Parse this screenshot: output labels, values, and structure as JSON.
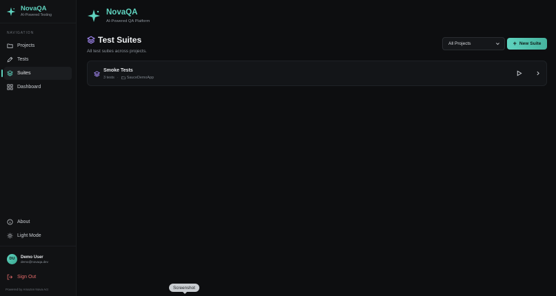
{
  "brand": {
    "name": "NovaQA",
    "tagline": "AI-Powered Testing"
  },
  "sidebar": {
    "heading": "NAVIGATION",
    "items": [
      {
        "label": "Projects",
        "icon": "folder-icon"
      },
      {
        "label": "Tests",
        "icon": "pencil-icon"
      },
      {
        "label": "Suites",
        "icon": "layers-icon",
        "active": true
      },
      {
        "label": "Dashboard",
        "icon": "grid-icon"
      }
    ],
    "about_label": "About",
    "light_mode_label": "Light Mode",
    "user": {
      "initials": "DU",
      "name": "Demo User",
      "email": "demo@novaqa.dev"
    },
    "sign_out_label": "Sign Out",
    "powered_by": "Powered by Amazon Nova Act"
  },
  "header": {
    "brand_name": "NovaQA",
    "brand_sub": "AI-Powered QA Platform"
  },
  "page": {
    "title": "Test Suites",
    "subtitle": "All test suites across projects.",
    "project_filter": {
      "selected": "All Projects"
    },
    "new_suite_label": "New Suite"
  },
  "suites": [
    {
      "name": "Smoke Tests",
      "tests": "3 tests",
      "project": "SauceDemoApp"
    }
  ],
  "tooltip": "Screenshot",
  "colors": {
    "accent": "#5fd3bf",
    "suite_icon": "#a78bfa",
    "danger": "#e36a6a",
    "background": "#0d0e10"
  }
}
